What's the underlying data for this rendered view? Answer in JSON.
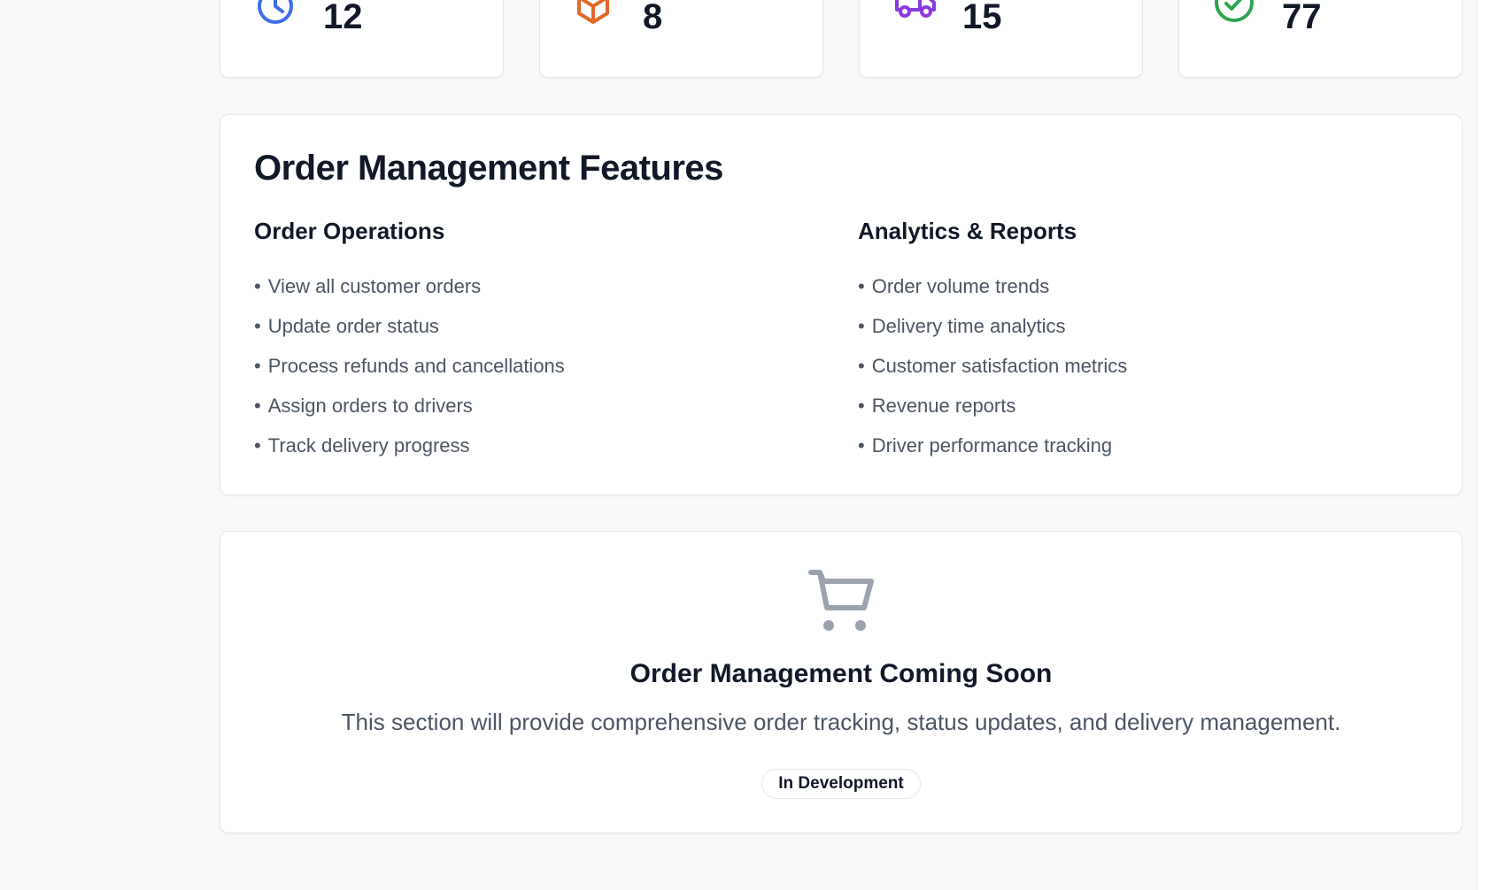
{
  "stats": [
    {
      "icon": "clock-icon",
      "value": "12",
      "color": "#3b6ee8"
    },
    {
      "icon": "package-icon",
      "value": "8",
      "color": "#e0692a"
    },
    {
      "icon": "truck-icon",
      "value": "15",
      "color": "#8b3ae0"
    },
    {
      "icon": "check-circle-icon",
      "value": "77",
      "color": "#2ea44f"
    }
  ],
  "features": {
    "title": "Order Management Features",
    "operations": {
      "heading": "Order Operations",
      "items": [
        "View all customer orders",
        "Update order status",
        "Process refunds and cancellations",
        "Assign orders to drivers",
        "Track delivery progress"
      ]
    },
    "analytics": {
      "heading": "Analytics & Reports",
      "items": [
        "Order volume trends",
        "Delivery time analytics",
        "Customer satisfaction metrics",
        "Revenue reports",
        "Driver performance tracking"
      ]
    }
  },
  "coming_soon": {
    "icon": "shopping-cart-icon",
    "title": "Order Management Coming Soon",
    "description": "This section will provide comprehensive order tracking, status updates, and delivery management.",
    "badge": "In Development"
  }
}
